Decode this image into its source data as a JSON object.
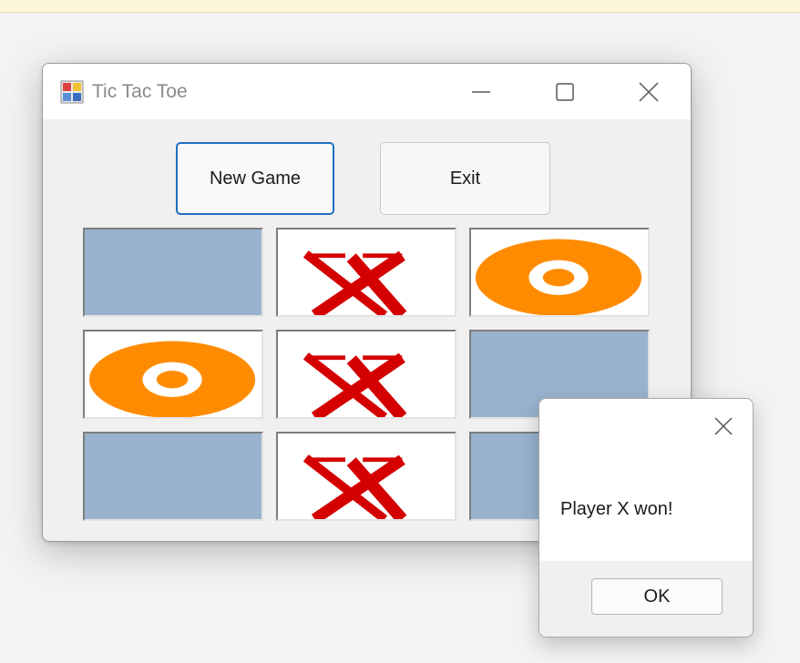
{
  "window": {
    "title": "Tic Tac Toe",
    "icon": "app-icon",
    "controls": [
      "minimize-icon",
      "maximize-icon",
      "close-icon"
    ]
  },
  "buttons": {
    "new_game": "New Game",
    "exit": "Exit"
  },
  "board": {
    "cells": [
      "",
      "X",
      "O",
      "O",
      "X",
      "",
      "",
      "X",
      ""
    ]
  },
  "dialog": {
    "message": "Player X won!",
    "ok_label": "OK"
  },
  "colors": {
    "empty_cell": "#99b3cf",
    "x_mark": "#d40000",
    "o_mark": "#ff8c00",
    "focus_border": "#1f6fc0"
  }
}
